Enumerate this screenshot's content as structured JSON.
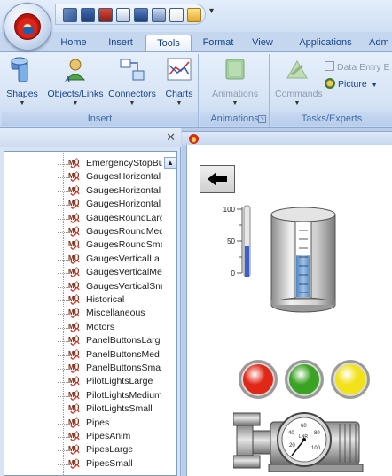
{
  "window": {
    "tabs": [
      {
        "label": "Home",
        "active": false
      },
      {
        "label": "Insert",
        "active": false
      },
      {
        "label": "Tools",
        "active": true
      },
      {
        "label": "Format",
        "active": false
      },
      {
        "label": "View",
        "active": false
      },
      {
        "label": "Applications",
        "active": false
      },
      {
        "label": "Adm",
        "active": false
      }
    ]
  },
  "ribbon": {
    "groups": {
      "insert": {
        "label": "Insert",
        "buttons": [
          "Shapes",
          "Objects/Links",
          "Connectors",
          "Charts"
        ]
      },
      "animations": {
        "label": "Animations",
        "buttons": [
          "Animations"
        ]
      },
      "tasks": {
        "label": "Tasks/Experts",
        "buttons": [
          "Commands"
        ],
        "small_buttons": [
          "Data Entry E",
          "Picture"
        ]
      }
    }
  },
  "tree": {
    "items": [
      "EmergencyStopBu",
      "GaugesHorizontal",
      "GaugesHorizontal",
      "GaugesHorizontal",
      "GaugesRoundLarg",
      "GaugesRoundMed",
      "GaugesRoundSma",
      "GaugesVerticalLa",
      "GaugesVerticalMe",
      "GaugesVerticalSm",
      "Historical",
      "Miscellaneous",
      "Motors",
      "PanelButtonsLarg",
      "PanelButtonsMed",
      "PanelButtonsSma",
      "PilotLightsLarge",
      "PilotLightsMedium",
      "PilotLightsSmall",
      "Pipes",
      "PipesAnim",
      "PipesLarge",
      "PipesSmall"
    ]
  },
  "canvas": {
    "thermometer": {
      "ticks": [
        "100",
        "50",
        "0"
      ],
      "level_percent": 45
    },
    "tank": {
      "level_percent": 55
    },
    "pilot_lights": [
      {
        "color_name": "red",
        "color": "#e02818"
      },
      {
        "color_name": "green",
        "color": "#3aa323"
      },
      {
        "color_name": "yellow",
        "color": "#f2e21a"
      }
    ],
    "pump_gauge": {
      "ticks": [
        "20",
        "40",
        "60",
        "80",
        "100"
      ],
      "unit": "LNR"
    }
  },
  "colors": {
    "ribbon_text": "#15428b",
    "accent": "#8ca9d3"
  }
}
